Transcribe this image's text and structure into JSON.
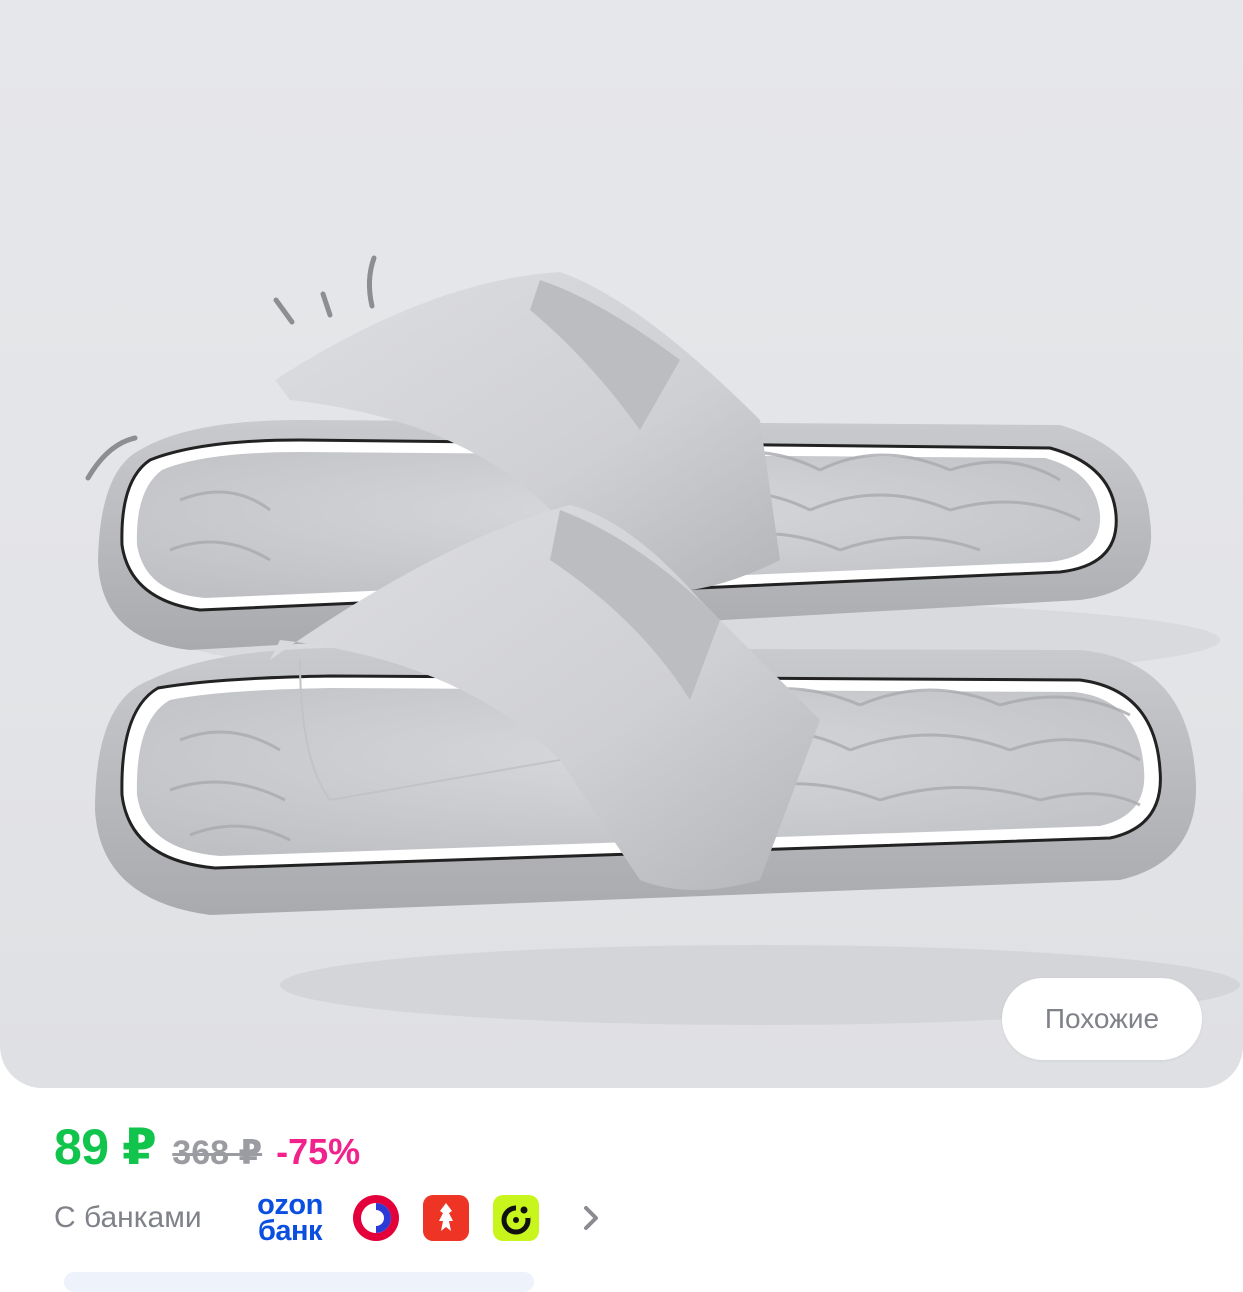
{
  "product": {
    "image_alt": "slippers-photo",
    "similar_label": "Похожие"
  },
  "price": {
    "current": "89 ₽",
    "old": "368 ₽",
    "discount": "-75%"
  },
  "banks": {
    "label": "С банками",
    "ozon_line1": "ozon",
    "ozon_line2": "банк",
    "icons": [
      "sber-bank-icon",
      "alfa-bank-icon",
      "mts-bank-icon"
    ]
  },
  "colors": {
    "price_green": "#10c44c",
    "discount_pink": "#f2228c",
    "ozon_blue": "#0b4fe0",
    "image_bg": "#e4e5e8"
  }
}
